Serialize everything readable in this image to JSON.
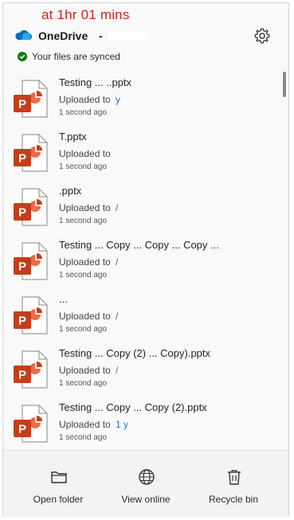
{
  "annotation": "at 1hr 01 mins",
  "header": {
    "app_title": "OneDrive",
    "title_separator": "-",
    "settings_icon": "gear-icon",
    "cloud_icon": "onedrive-cloud-icon",
    "cloud_color": "#0f6cbd"
  },
  "status": {
    "text": "Your files are synced",
    "icon": "check-circle-icon",
    "color": "#107c10"
  },
  "files": [
    {
      "name": "Testing ... ..pptx",
      "uploaded_label": "Uploaded to",
      "uploaded_target": "y",
      "time": "1 second ago"
    },
    {
      "name": "T.pptx",
      "uploaded_label": "Uploaded to",
      "uploaded_target": "",
      "time": "1 second ago"
    },
    {
      "name": ".pptx",
      "uploaded_label": "Uploaded to",
      "uploaded_target": "/",
      "time": "1 second ago"
    },
    {
      "name": "Testing ... Copy ... Copy ... Copy ...",
      "uploaded_label": "Uploaded to",
      "uploaded_target": "/",
      "time": "1 second ago"
    },
    {
      "name": "...",
      "uploaded_label": "Uploaded to",
      "uploaded_target": "/",
      "time": "1 second ago"
    },
    {
      "name": "Testing ... Copy (2) ... Copy).pptx",
      "uploaded_label": "Uploaded to",
      "uploaded_target": "/",
      "time": "1 second ago"
    },
    {
      "name": "Testing ... Copy ... Copy (2).pptx",
      "uploaded_label": "Uploaded to",
      "uploaded_target": "1 y",
      "time": "1 second ago"
    }
  ],
  "file_icon": "powerpoint-file-icon",
  "ppt_color": "#c43e1c",
  "link_color": "#1a73c9",
  "footer": {
    "open_folder": {
      "label": "Open folder",
      "icon": "folder-icon"
    },
    "view_online": {
      "label": "View online",
      "icon": "globe-icon"
    },
    "recycle_bin": {
      "label": "Recycle bin",
      "icon": "trash-icon"
    }
  }
}
